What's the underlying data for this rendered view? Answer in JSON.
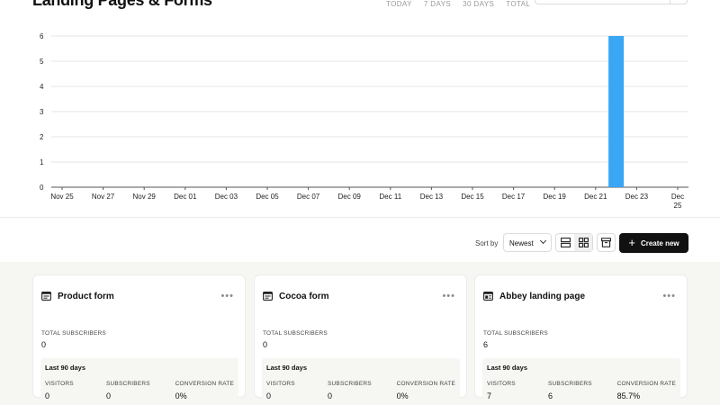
{
  "header": {
    "title": "Landing Pages & Forms",
    "range_tabs": [
      "TODAY",
      "7 DAYS",
      "30 DAYS",
      "TOTAL"
    ]
  },
  "chart_data": {
    "type": "bar",
    "categories": [
      "Nov 25",
      "Nov 27",
      "Nov 29",
      "Dec 01",
      "Dec 03",
      "Dec 05",
      "Dec 07",
      "Dec 09",
      "Dec 11",
      "Dec 13",
      "Dec 15",
      "Dec 17",
      "Dec 19",
      "Dec 21",
      "Dec 23",
      "Dec 25"
    ],
    "x_tick_labels": [
      "Nov 25",
      "Nov 27",
      "Nov 29",
      "Dec 01",
      "Dec 03",
      "Dec 05",
      "Dec 07",
      "Dec 09",
      "Dec 11",
      "Dec 13",
      "Dec 15",
      "Dec 17",
      "Dec 19",
      "Dec 21",
      "Dec 23",
      "Dec\n25"
    ],
    "y_ticks": [
      0,
      1,
      2,
      3,
      4,
      5,
      6
    ],
    "ylim": [
      0,
      6
    ],
    "grid": true,
    "bar_color": "#3aa7f5",
    "bars": [
      {
        "x": "Dec 22",
        "value": 6
      }
    ]
  },
  "toolbar": {
    "sort_label": "Sort by",
    "sort_value": "Newest",
    "create_label": "Create new"
  },
  "cards": [
    {
      "icon": "form-icon",
      "title": "Product form",
      "total_label": "TOTAL SUBSCRIBERS",
      "total_value": "0",
      "period": "Last 90 days",
      "visitors_label": "VISITORS",
      "visitors": "0",
      "subscribers_label": "SUBSCRIBERS",
      "subscribers": "0",
      "conversion_label": "CONVERSION RATE",
      "conversion": "0%"
    },
    {
      "icon": "form-icon",
      "title": "Cocoa form",
      "total_label": "TOTAL SUBSCRIBERS",
      "total_value": "0",
      "period": "Last 90 days",
      "visitors_label": "VISITORS",
      "visitors": "0",
      "subscribers_label": "SUBSCRIBERS",
      "subscribers": "0",
      "conversion_label": "CONVERSION RATE",
      "conversion": "0%"
    },
    {
      "icon": "landing-page-icon",
      "title": "Abbey landing page",
      "total_label": "TOTAL SUBSCRIBERS",
      "total_value": "6",
      "period": "Last 90 days",
      "visitors_label": "VISITORS",
      "visitors": "7",
      "subscribers_label": "SUBSCRIBERS",
      "subscribers": "6",
      "conversion_label": "CONVERSION RATE",
      "conversion": "85.7%"
    }
  ]
}
